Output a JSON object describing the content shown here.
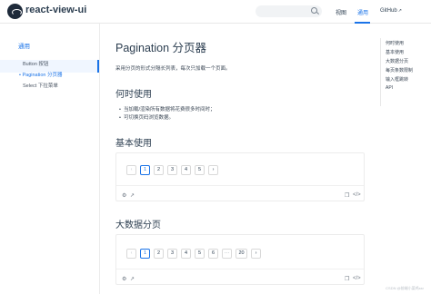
{
  "header": {
    "site_title": "react-view-ui",
    "nav": {
      "home": "视图",
      "components": "通用",
      "github": "GitHub"
    }
  },
  "sidebar": {
    "group_title": "通用",
    "items": [
      {
        "label": "Button 按钮",
        "active": false
      },
      {
        "label": "Pagination 分页器",
        "active": true
      },
      {
        "label": "Select 下拉菜单",
        "active": false
      }
    ]
  },
  "main": {
    "title": "Pagination 分页器",
    "description": "采用分页的形式分隔长列表，每次只加载一个页面。",
    "when_heading": "何时使用",
    "when_items": [
      "当加载/渲染所有数据将花费很多时间时；",
      "可切换页码浏览数据。"
    ],
    "basic_heading": "基本使用",
    "basic_pager": [
      "‹",
      "1",
      "2",
      "3",
      "4",
      "5",
      "›"
    ],
    "big_heading": "大数据分页",
    "big_pager": [
      "‹",
      "1",
      "2",
      "3",
      "4",
      "5",
      "6",
      "···",
      "20",
      "›"
    ]
  },
  "toc": {
    "items": [
      "何时使用",
      "基本使用",
      "大数据分页",
      "每页条数限制",
      "输入框跳转",
      "API"
    ]
  },
  "watermark": "CSDN @前端小菜鸡ssr"
}
